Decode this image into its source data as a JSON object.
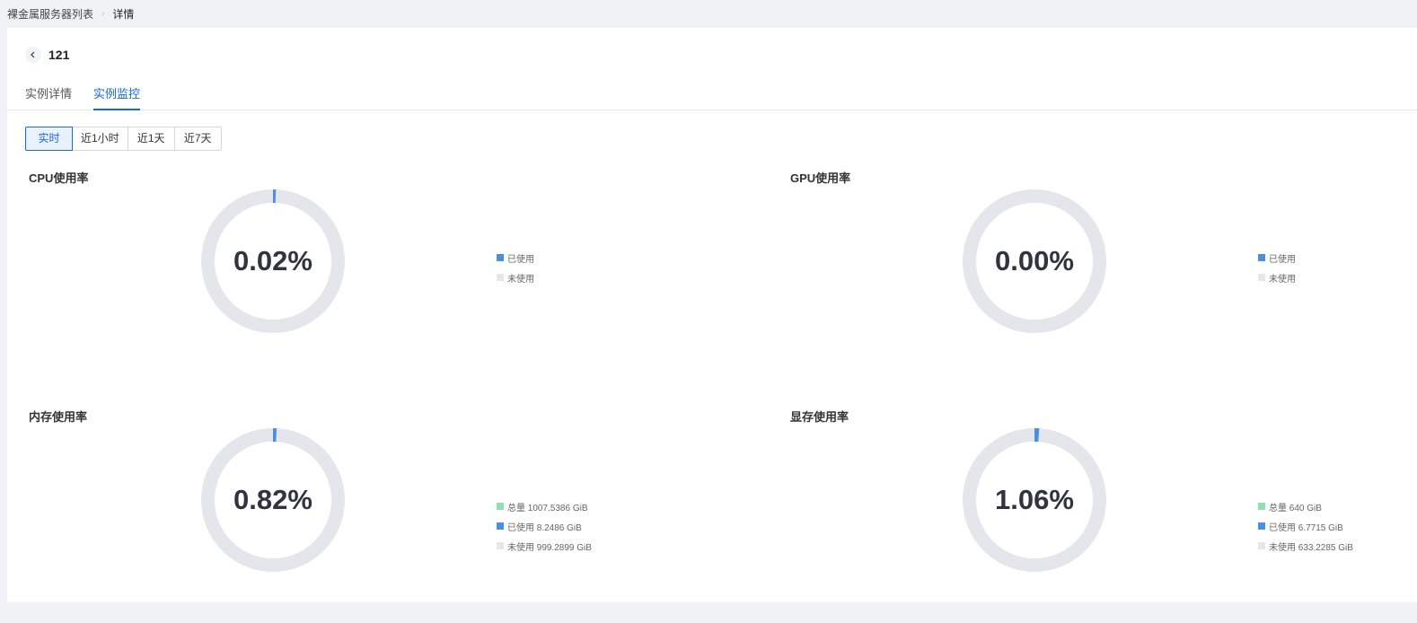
{
  "breadcrumb": {
    "parent": "裸金属服务器列表",
    "current": "详情"
  },
  "header": {
    "instance_name": "121"
  },
  "tabs": [
    {
      "label": "实例详情",
      "active": false
    },
    {
      "label": "实例监控",
      "active": true
    }
  ],
  "time_range": {
    "options": [
      "实时",
      "近1小时",
      "近1天",
      "近7天"
    ],
    "selected": "实时"
  },
  "colors": {
    "accent": "#1668dc",
    "used": "#4a90e2",
    "unused": "#e5e6eb",
    "total": "#8ee0b4"
  },
  "panels": {
    "cpu": {
      "title": "CPU使用率",
      "value_text": "0.02%",
      "percent": 0.02,
      "legend": [
        {
          "label": "已使用",
          "color": "#4a90e2"
        },
        {
          "label": "未使用",
          "color": "#e5e6eb"
        }
      ]
    },
    "gpu": {
      "title": "GPU使用率",
      "value_text": "0.00%",
      "percent": 0.0,
      "legend": [
        {
          "label": "已使用",
          "color": "#4a90e2"
        },
        {
          "label": "未使用",
          "color": "#e5e6eb"
        }
      ]
    },
    "memory": {
      "title": "内存使用率",
      "value_text": "0.82%",
      "percent": 0.82,
      "legend": [
        {
          "label": "总量 1007.5386 GiB",
          "color": "#8ee0b4"
        },
        {
          "label": "已使用 8.2486 GiB",
          "color": "#4a90e2"
        },
        {
          "label": "未使用 999.2899 GiB",
          "color": "#e5e6eb"
        }
      ]
    },
    "vram": {
      "title": "显存使用率",
      "value_text": "1.06%",
      "percent": 1.06,
      "legend": [
        {
          "label": "总量 640 GiB",
          "color": "#8ee0b4"
        },
        {
          "label": "已使用 6.7715 GiB",
          "color": "#4a90e2"
        },
        {
          "label": "未使用 633.2285 GiB",
          "color": "#e5e6eb"
        }
      ]
    }
  }
}
